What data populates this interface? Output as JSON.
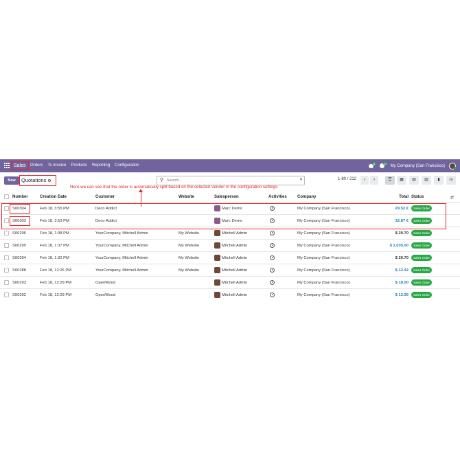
{
  "navbar": {
    "brand": "Sales",
    "menu": [
      "Orders",
      "To Invoice",
      "Products",
      "Reporting",
      "Configuration"
    ],
    "chat_badge": "11",
    "activity_badge": "24",
    "company": "My Company (San Francisco)"
  },
  "control": {
    "new_label": "New",
    "breadcrumb": "Quotations",
    "search_placeholder": "Search...",
    "pager": "1-80 / 212",
    "annotation": "Here we can see that the order is automatically split based on the selected Vendor in the configuration settings"
  },
  "table": {
    "headers": {
      "number": "Number",
      "creation_date": "Creation Date",
      "customer": "Customer",
      "website": "Website",
      "salesperson": "Salesperson",
      "activities": "Activities",
      "company": "Company",
      "total": "Total",
      "status": "Status"
    },
    "rows": [
      {
        "number": "S00304",
        "date": "Feb 18, 3:55 PM",
        "customer": "Deco Addict",
        "website": "",
        "salesperson": "Marc Demo",
        "company": "My Company (San Francisco)",
        "total": "29.52 €",
        "status": "Sales Order"
      },
      {
        "number": "S00303",
        "date": "Feb 18, 3:53 PM",
        "customer": "Deco Addict",
        "website": "",
        "salesperson": "Marc Demo",
        "company": "My Company (San Francisco)",
        "total": "22.87 €",
        "status": "Sales Order"
      },
      {
        "number": "S00296",
        "date": "Feb 18, 1:38 PM",
        "customer": "YourCompany, Mitchell Admin",
        "website": "My Website",
        "salesperson": "Mitchell Admin",
        "company": "My Company (San Francisco)",
        "total": "$ 20.70",
        "status": "Sales Order"
      },
      {
        "number": "S00295",
        "date": "Feb 18, 1:37 PM",
        "customer": "YourCompany, Mitchell Admin",
        "website": "My Website",
        "salesperson": "Mitchell Admin",
        "company": "My Company (San Francisco)",
        "total": "$ 1,035.00",
        "status": "Sales Order"
      },
      {
        "number": "S00294",
        "date": "Feb 18, 1:32 PM",
        "customer": "YourCompany, Mitchell Admin",
        "website": "My Website",
        "salesperson": "Mitchell Admin",
        "company": "My Company (San Francisco)",
        "total": "$ 20.70",
        "status": "Sales Order"
      },
      {
        "number": "S00288",
        "date": "Feb 18, 12:26 PM",
        "customer": "YourCompany, Mitchell Admin",
        "website": "My Website",
        "salesperson": "Mitchell Admin",
        "company": "My Company (San Francisco)",
        "total": "$ 12.42",
        "status": "Sales Order"
      },
      {
        "number": "S00293",
        "date": "Feb 18, 12:29 PM",
        "customer": "OpenWood",
        "website": "",
        "salesperson": "Mitchell Admin",
        "company": "My Company (San Francisco)",
        "total": "$ 18.00",
        "status": "Sales Order"
      },
      {
        "number": "S00292",
        "date": "Feb 18, 12:29 PM",
        "customer": "OpenWood",
        "website": "",
        "salesperson": "Mitchell Admin",
        "company": "My Company (San Francisco)",
        "total": "$ 13.95",
        "status": "Sales Order"
      }
    ]
  },
  "colors": {
    "navbar": "#71639e",
    "annotation": "#e3252b",
    "status_green": "#28a745",
    "total_euro": "#1a7fb5"
  }
}
